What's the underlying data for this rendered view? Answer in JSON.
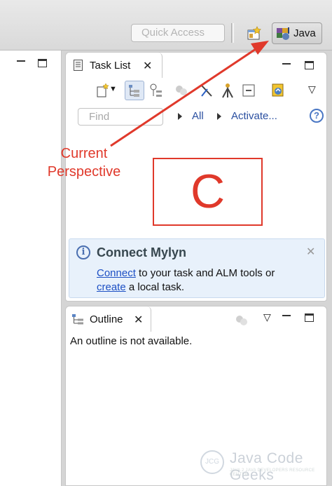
{
  "toolbar": {
    "quick_access_placeholder": "Quick Access",
    "perspectives": [
      {
        "name": "open-perspective",
        "label": ""
      },
      {
        "name": "java",
        "label": "Java"
      }
    ]
  },
  "task_list": {
    "tab_title": "Task List",
    "find_placeholder": "Find",
    "filter_all": "All",
    "filter_activate": "Activate...",
    "help": "?"
  },
  "mylyn": {
    "title": "Connect Mylyn",
    "info": "i",
    "line1_link": "Connect",
    "line1_rest": " to your task and ALM tools or",
    "line2_link": "create",
    "line2_rest": " a local task."
  },
  "outline": {
    "tab_title": "Outline",
    "message": "An outline is not available."
  },
  "annotation": {
    "label_line1": "Current",
    "label_line2": "Perspective",
    "box_letter": "C",
    "color": "#e0392b"
  },
  "watermark": {
    "text": "Java Code Geeks",
    "logo": "JCG",
    "tagline": "JAVA 2 JAVA DEVELOPERS RESOURCE CENTER"
  },
  "colors": {
    "accent_link": "#1c4fc4",
    "filter_link": "#2a4fa0",
    "mylyn_bg": "#e8f1fb"
  }
}
